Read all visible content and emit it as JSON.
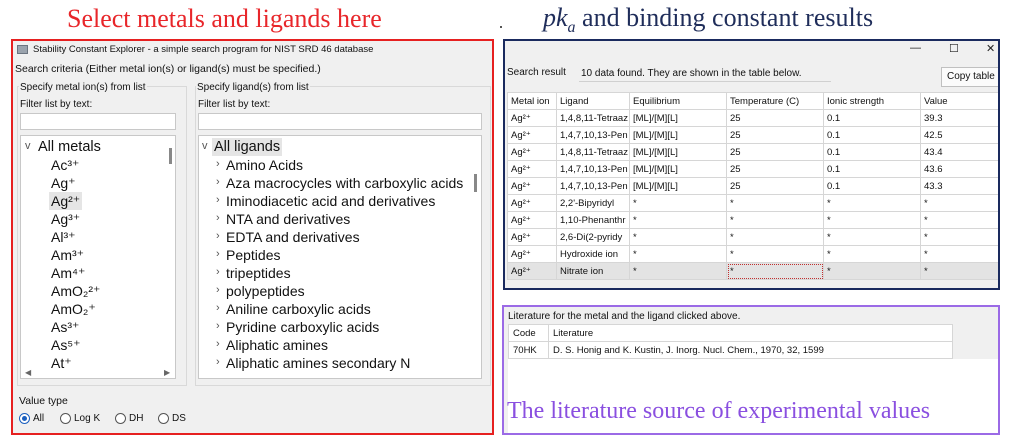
{
  "annotations": {
    "left_title": "Select metals and ligands here",
    "right_title_var": "pk",
    "right_title_sub": "a",
    "right_title_rest": " and binding constant results",
    "bottom_title": "The literature source of experimental values"
  },
  "colors": {
    "red_frame": "#e62020",
    "navy_frame": "#1a2a5e",
    "purple_frame": "#9b6ae6",
    "accent": "#1a5fbf"
  },
  "left_window": {
    "title": "Stability Constant Explorer - a simple search program for NIST SRD 46 database",
    "criteria": "Search criteria (Either metal ion(s) or ligand(s) must be specified.)",
    "metal_group_label": "Specify metal ion(s) from list",
    "ligand_group_label": "Specify ligand(s) from list",
    "metal_filter_label": "Filter list by text:",
    "ligand_filter_label": "Filter list by text:",
    "metal_filter_value": "",
    "ligand_filter_value": "",
    "metals_root": "All metals",
    "metals": [
      "Ac³⁺",
      "Ag⁺",
      "Ag²⁺",
      "Ag³⁺",
      "Al³⁺",
      "Am³⁺",
      "Am⁴⁺",
      "AmO₂²⁺",
      "AmO₂⁺",
      "As³⁺",
      "As⁵⁺",
      "At⁺"
    ],
    "selected_metal": "Ag²⁺",
    "ligands_root": "All ligands",
    "ligands": [
      "Amino Acids",
      "Aza macrocycles with carboxylic acids",
      "Iminodiacetic acid and derivatives",
      "NTA and derivatives",
      "EDTA and derivatives",
      "Peptides",
      "tripeptides",
      "polypeptides",
      "Aniline carboxylic acids",
      "Pyridine carboxylic acids",
      "Aliphatic amines",
      "Aliphatic amines secondary N"
    ],
    "value_type_label": "Value type",
    "value_types": [
      "All",
      "Log K",
      "DH",
      "DS"
    ],
    "selected_value_type": "All"
  },
  "results_window": {
    "controls": {
      "minimize": "—",
      "maximize": "☐",
      "close": "✕"
    },
    "search_result_label": "Search result",
    "message": "10 data found. They are shown in the table below.",
    "copy_button": "Copy table",
    "columns": [
      "Metal ion",
      "Ligand",
      "Equilibrium",
      "Temperature (C)",
      "Ionic strength",
      "Value"
    ],
    "rows": [
      [
        "Ag²⁺",
        "1,4,8,11-Tetraaz",
        "[ML]/[M][L]",
        "25",
        "0.1",
        "39.3"
      ],
      [
        "Ag²⁺",
        "1,4,7,10,13-Pen",
        "[ML]/[M][L]",
        "25",
        "0.1",
        "42.5"
      ],
      [
        "Ag²⁺",
        "1,4,8,11-Tetraaz",
        "[ML]/[M][L]",
        "25",
        "0.1",
        "43.4"
      ],
      [
        "Ag²⁺",
        "1,4,7,10,13-Pen",
        "[ML]/[M][L]",
        "25",
        "0.1",
        "43.6"
      ],
      [
        "Ag²⁺",
        "1,4,7,10,13-Pen",
        "[ML]/[M][L]",
        "25",
        "0.1",
        "43.3"
      ],
      [
        "Ag²⁺",
        "2,2'-Bipyridyl",
        "*",
        "*",
        "*",
        "*"
      ],
      [
        "Ag²⁺",
        "1,10-Phenanthr",
        "*",
        "*",
        "*",
        "*"
      ],
      [
        "Ag²⁺",
        "2,6-Di(2-pyridy",
        "*",
        "*",
        "*",
        "*"
      ],
      [
        "Ag²⁺",
        "Hydroxide ion",
        "*",
        "*",
        "*",
        "*"
      ],
      [
        "Ag²⁺",
        "Nitrate ion",
        "*",
        "*",
        "*",
        "*"
      ]
    ]
  },
  "literature_window": {
    "title": "Literature for the metal and the ligand clicked above.",
    "columns": [
      "Code",
      "Literature"
    ],
    "rows": [
      [
        "70HK",
        "D. S. Honig and K. Kustin, J. Inorg. Nucl. Chem., 1970, 32, 1599"
      ]
    ]
  }
}
